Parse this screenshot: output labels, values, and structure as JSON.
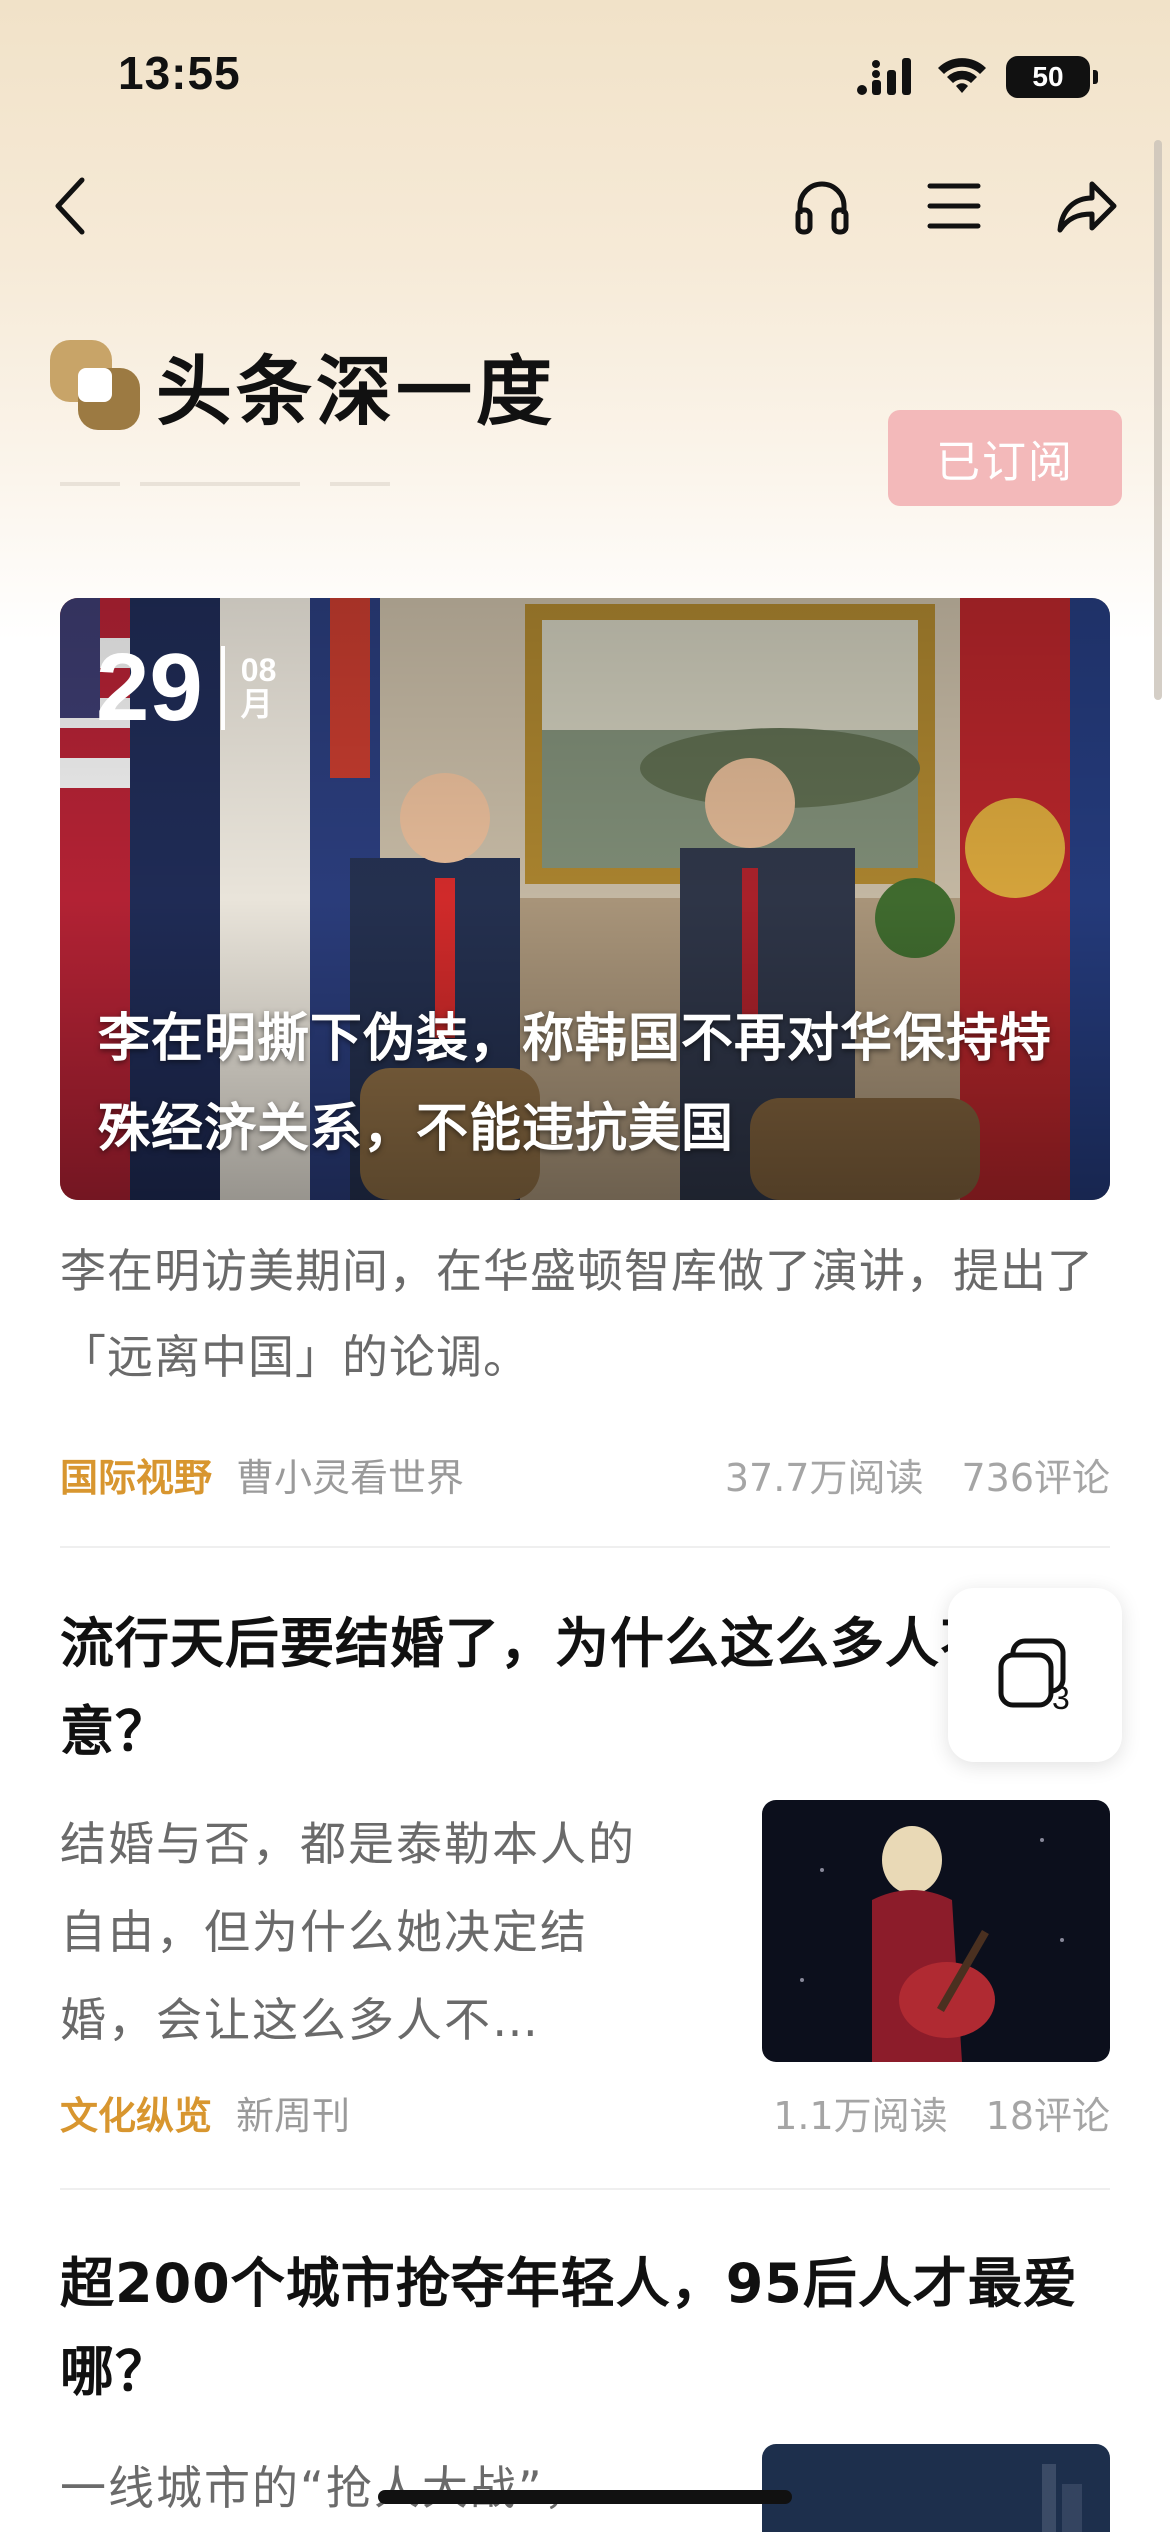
{
  "status_bar": {
    "time": "13:55",
    "battery": "50"
  },
  "nav": {
    "back_icon": "chevron-left-icon",
    "audio_icon": "headphones-icon",
    "menu_icon": "menu-icon",
    "share_icon": "share-icon"
  },
  "brand": {
    "title": "头条深一度",
    "subscribe_label": "已订阅",
    "accent": "#b8955a"
  },
  "hero": {
    "day": "29",
    "month_num": "08",
    "month_unit": "月",
    "title": "李在明撕下伪装，称韩国不再对华保持特殊经济关系，不能违抗美国",
    "summary": "李在明访美期间，在华盛顿智库做了演讲，提出了「远离中国」的论调。",
    "category": "国际视野",
    "author": "曹小灵看世界",
    "reads": "37.7万阅读",
    "comments": "736评论"
  },
  "articles": [
    {
      "title": "流行天后要结婚了，为什么这么多人不乐意？",
      "summary": "结婚与否，都是泰勒本人的自由，但为什么她决定结婚，会让这么多人不…",
      "category": "文化纵览",
      "author": "新周刊",
      "reads": "1.1万阅读",
      "comments": "18评论"
    },
    {
      "title": "超200个城市抢夺年轻人，95后人才最爱哪？",
      "summary": "一线城市的“抢人大战”，"
    }
  ],
  "floating": {
    "icon": "multi-window-icon",
    "count": "3"
  },
  "colors": {
    "category": "#d8962f",
    "subscribe_bg": "#f3b9ba"
  }
}
